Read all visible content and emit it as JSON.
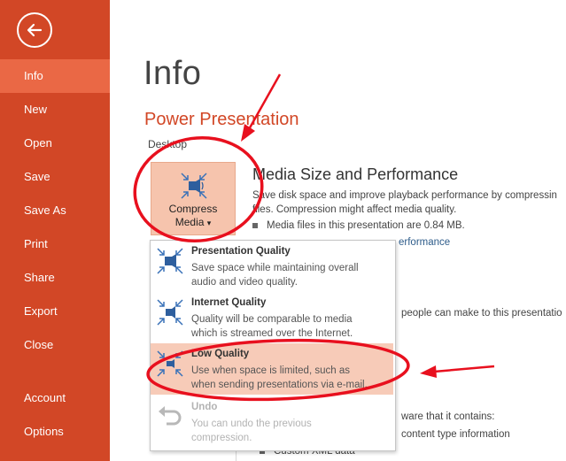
{
  "sidebar": {
    "back_label": "Back",
    "items": [
      {
        "label": "Info",
        "active": true
      },
      {
        "label": "New"
      },
      {
        "label": "Open"
      },
      {
        "label": "Save"
      },
      {
        "label": "Save As"
      },
      {
        "label": "Print"
      },
      {
        "label": "Share"
      },
      {
        "label": "Export"
      },
      {
        "label": "Close"
      },
      {
        "label": "Account"
      },
      {
        "label": "Options"
      }
    ]
  },
  "main": {
    "title": "Info",
    "document_title": "Power Presentation",
    "location": "Desktop",
    "compress_button": {
      "line1": "Compress",
      "line2": "Media",
      "caret": "▾"
    },
    "media_section": {
      "title": "Media Size and Performance",
      "desc_line1": "Save disk space and improve playback performance by compressin",
      "desc_line2": "files. Compression might affect media quality.",
      "bullet1": "Media files in this presentation are 0.84 MB.",
      "link_partial": "erformance"
    },
    "partial_texts": [
      "people can make to this presentatio",
      "ware that it contains:",
      "content type information",
      "Custom XML data"
    ]
  },
  "compress_menu": {
    "items": [
      {
        "title": "Presentation Quality",
        "desc": "Save space while maintaining overall\naudio and video quality.",
        "state": "normal"
      },
      {
        "title": "Internet Quality",
        "desc": "Quality will be comparable to media\nwhich is streamed over the Internet.",
        "state": "normal"
      },
      {
        "title": "Low Quality",
        "desc": "Use when space is limited, such as\nwhen sending presentations via e-mail.",
        "state": "selected"
      },
      {
        "title": "Undo",
        "desc": "You can undo the previous\ncompression.",
        "state": "disabled"
      }
    ]
  },
  "colors": {
    "sidebar_bg": "#d24726",
    "sidebar_active": "#ea6845",
    "accent": "#d24726",
    "selected_menu": "#f7cbb8",
    "annotation_red": "#e8101e"
  },
  "icons": {
    "back": "arrow-left-icon",
    "compress": "compress-media-icon",
    "undo": "undo-icon"
  }
}
